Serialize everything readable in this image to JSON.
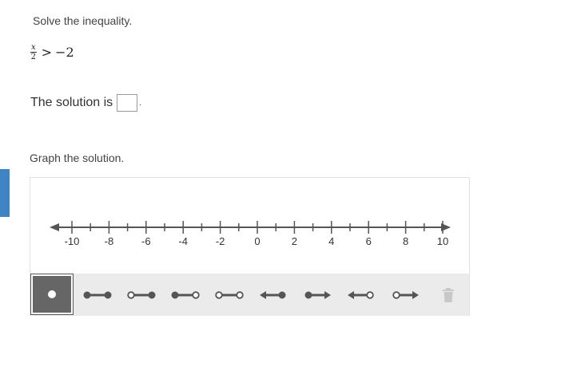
{
  "question": {
    "prompt": "Solve the inequality.",
    "fraction_numerator": "x",
    "fraction_denominator": "2",
    "relation": ">",
    "rhs": "−2",
    "solution_prefix": "The solution is",
    "solution_suffix": ".",
    "answer_value": ""
  },
  "graph": {
    "prompt": "Graph the solution.",
    "number_line": {
      "min": -10,
      "max": 10,
      "tick_step": 1,
      "labels": [
        "-10",
        "-8",
        "-6",
        "-4",
        "-2",
        "0",
        "2",
        "4",
        "6",
        "8",
        "10"
      ]
    },
    "tools": [
      {
        "name": "point",
        "icon": "point-icon",
        "selected": true
      },
      {
        "name": "segment-closed-closed",
        "icon": "closed-closed-segment-icon",
        "selected": false
      },
      {
        "name": "segment-open-closed",
        "icon": "open-closed-segment-icon",
        "selected": false
      },
      {
        "name": "segment-closed-open",
        "icon": "closed-open-segment-icon",
        "selected": false
      },
      {
        "name": "segment-open-open",
        "icon": "open-open-segment-icon",
        "selected": false
      },
      {
        "name": "ray-left-closed",
        "icon": "left-ray-closed-icon",
        "selected": false
      },
      {
        "name": "ray-right-closed",
        "icon": "right-ray-closed-icon",
        "selected": false
      },
      {
        "name": "ray-left-open",
        "icon": "left-ray-open-icon",
        "selected": false
      },
      {
        "name": "ray-right-open",
        "icon": "right-ray-open-icon",
        "selected": false
      },
      {
        "name": "delete",
        "icon": "trash-icon",
        "selected": false
      }
    ]
  },
  "colors": {
    "accent": "#3f84c5",
    "toolbar_bg": "#ebebeb",
    "tool_selected_bg": "#666666",
    "line": "#555555"
  }
}
